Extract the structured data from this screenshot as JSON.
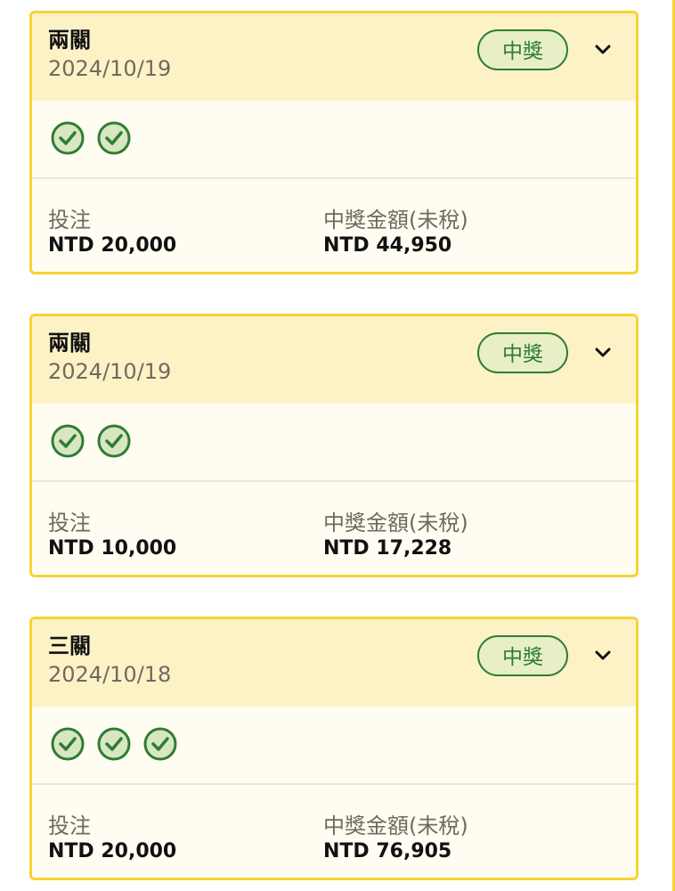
{
  "colors": {
    "accent": "#f5d431",
    "win_green": "#2e7d32",
    "header_bg": "#fdf2c6",
    "card_bg": "#fffcf2"
  },
  "labels": {
    "stake": "投注",
    "payout": "中獎金額(未稅)"
  },
  "cards": [
    {
      "type": "兩關",
      "date": "2024/10/19",
      "status": "中獎",
      "legs": [
        "check-circle-icon",
        "check-circle-icon"
      ],
      "stake": "NTD 20,000",
      "payout": "NTD 44,950"
    },
    {
      "type": "兩關",
      "date": "2024/10/19",
      "status": "中獎",
      "legs": [
        "check-circle-icon",
        "check-circle-icon"
      ],
      "stake": "NTD 10,000",
      "payout": "NTD 17,228"
    },
    {
      "type": "三關",
      "date": "2024/10/18",
      "status": "中獎",
      "legs": [
        "check-circle-icon",
        "check-circle-icon",
        "check-circle-icon"
      ],
      "stake": "NTD 20,000",
      "payout": "NTD 76,905"
    }
  ]
}
